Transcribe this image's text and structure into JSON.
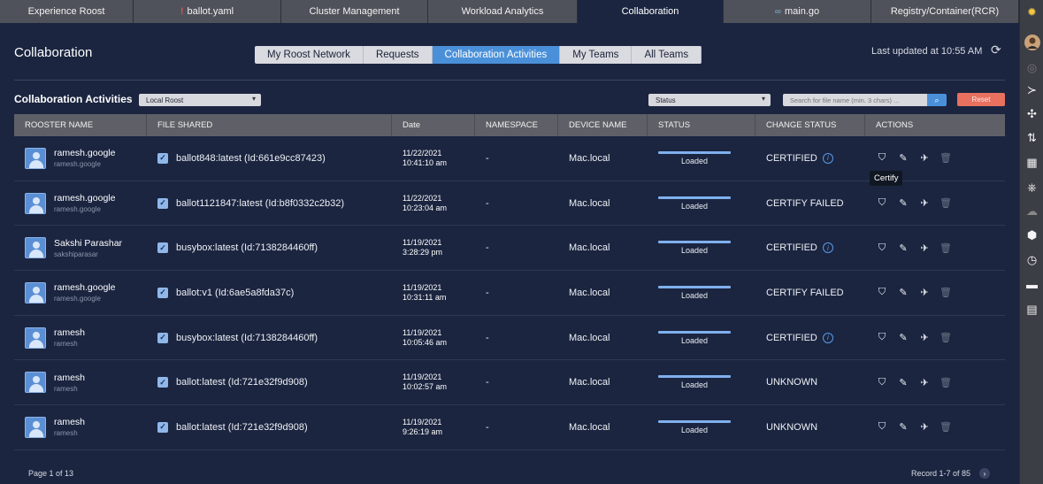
{
  "tabs": [
    {
      "label": "Experience Roost",
      "width": 151,
      "active": false
    },
    {
      "label": "ballot.yaml",
      "width": 167,
      "active": false,
      "mark": "yaml"
    },
    {
      "label": "Cluster Management",
      "width": 166,
      "active": false
    },
    {
      "label": "Workload Analytics",
      "width": 169,
      "active": false
    },
    {
      "label": "Collaboration",
      "width": 165,
      "active": true
    },
    {
      "label": "main.go",
      "width": 167,
      "active": false,
      "mark": "go"
    },
    {
      "label": "Registry/Container(RCR)",
      "width": 167,
      "active": false
    }
  ],
  "header": {
    "title": "Collaboration",
    "last_updated": "Last updated at 10:55 AM"
  },
  "nav": [
    {
      "label": "My Roost Network",
      "active": false
    },
    {
      "label": "Requests",
      "active": false
    },
    {
      "label": "Collaboration Activities",
      "active": true
    },
    {
      "label": "My Teams",
      "active": false
    },
    {
      "label": "All Teams",
      "active": false
    }
  ],
  "toolbar": {
    "section_title": "Collaboration Activities",
    "scope_value": "Local Roost",
    "status_value": "Status",
    "search_placeholder": "Search for file name (min. 3 chars) ...",
    "reset_label": "Reset"
  },
  "columns": [
    "ROOSTER NAME",
    "FILE SHARED",
    "Date",
    "NAMESPACE",
    "DEVICE NAME",
    "STATUS",
    "CHANGE STATUS",
    "ACTIONS"
  ],
  "rows": [
    {
      "name": "ramesh.google",
      "sub": "ramesh.google",
      "file": "ballot848:latest (Id:661e9cc87423)",
      "date": "11/22/2021",
      "time": "10:41:10 am",
      "namespace": "-",
      "device": "Mac.local",
      "status": "Loaded",
      "change_status": "CERTIFIED",
      "info": true
    },
    {
      "name": "ramesh.google",
      "sub": "ramesh.google",
      "file": "ballot1121847:latest (Id:b8f0332c2b32)",
      "date": "11/22/2021",
      "time": "10:23:04 am",
      "namespace": "-",
      "device": "Mac.local",
      "status": "Loaded",
      "change_status": "CERTIFY FAILED",
      "info": false
    },
    {
      "name": "Sakshi Parashar",
      "sub": "sakshiparasar",
      "file": "busybox:latest (Id:7138284460ff)",
      "date": "11/19/2021",
      "time": "3:28:29 pm",
      "namespace": "-",
      "device": "Mac.local",
      "status": "Loaded",
      "change_status": "CERTIFIED",
      "info": true
    },
    {
      "name": "ramesh.google",
      "sub": "ramesh.google",
      "file": "ballot:v1 (Id:6ae5a8fda37c)",
      "date": "11/19/2021",
      "time": "10:31:11 am",
      "namespace": "-",
      "device": "Mac.local",
      "status": "Loaded",
      "change_status": "CERTIFY FAILED",
      "info": false
    },
    {
      "name": "ramesh",
      "sub": "ramesh",
      "file": "busybox:latest (Id:7138284460ff)",
      "date": "11/19/2021",
      "time": "10:05:46 am",
      "namespace": "-",
      "device": "Mac.local",
      "status": "Loaded",
      "change_status": "CERTIFIED",
      "info": true
    },
    {
      "name": "ramesh",
      "sub": "ramesh",
      "file": "ballot:latest (Id:721e32f9d908)",
      "date": "11/19/2021",
      "time": "10:02:57 am",
      "namespace": "-",
      "device": "Mac.local",
      "status": "Loaded",
      "change_status": "UNKNOWN",
      "info": false
    },
    {
      "name": "ramesh",
      "sub": "ramesh",
      "file": "ballot:latest (Id:721e32f9d908)",
      "date": "11/19/2021",
      "time": "9:26:19 am",
      "namespace": "-",
      "device": "Mac.local",
      "status": "Loaded",
      "change_status": "UNKNOWN",
      "info": false
    }
  ],
  "tooltip": "Certify",
  "footer": {
    "page": "Page 1 of 13",
    "records": "Record 1-7 of 85"
  },
  "icons": {
    "refresh": "refresh-icon",
    "search": "search-icon",
    "actions": [
      "certify-shield-icon",
      "edit-icon",
      "deploy-icon",
      "trash-icon"
    ]
  },
  "colors": {
    "accent": "#4a90d9",
    "reset": "#e8705f",
    "background": "#1b2540"
  }
}
